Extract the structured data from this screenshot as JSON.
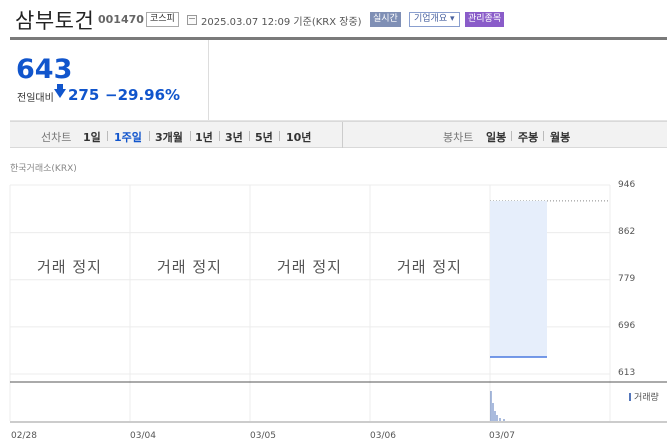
{
  "header": {
    "stock_name": "삼부토건",
    "stock_code": "001470",
    "market_badge": "코스피",
    "calendar_icon": "calendar-icon",
    "timestamp": "2025.03.07 12:09 기준(KRX 장중)",
    "realtime_button": "실시간",
    "company_button": "기업개요 ▾",
    "manage_badge": "관리종목"
  },
  "price": {
    "current": "643",
    "change_label": "전일대비",
    "change_icon": "arrow-down-icon",
    "change": "275",
    "change_pct": "−29.96%",
    "color": "#1155cc"
  },
  "period_bar": {
    "line_label": "선차트",
    "line_options": [
      "1일",
      "1주일",
      "3개월",
      "1년",
      "3년",
      "5년",
      "10년"
    ],
    "active": "1주일",
    "candle_label": "봉차트",
    "candle_options": [
      "일봉",
      "주봉",
      "월봉"
    ]
  },
  "exchange_label": "한국거래소(KRX)",
  "chart_data": {
    "type": "line",
    "y_ticks": [
      "946",
      "862",
      "779",
      "696",
      "613"
    ],
    "ylim": [
      613,
      946
    ],
    "x_ticks": [
      "02/28",
      "03/04",
      "03/05",
      "03/06",
      "03/07"
    ],
    "halted_text": "거래 정지",
    "halted_days": [
      "02/28",
      "03/04",
      "03/05",
      "03/06"
    ],
    "series": [
      {
        "values": [
          {
            "x": "03/07",
            "y": 643
          }
        ]
      }
    ],
    "previous_close": 918,
    "line_color": "#4a78e0",
    "fill_color": "#e6eefb",
    "volume_label": "거래량",
    "volume_color": "#5577bb",
    "grid": true
  }
}
